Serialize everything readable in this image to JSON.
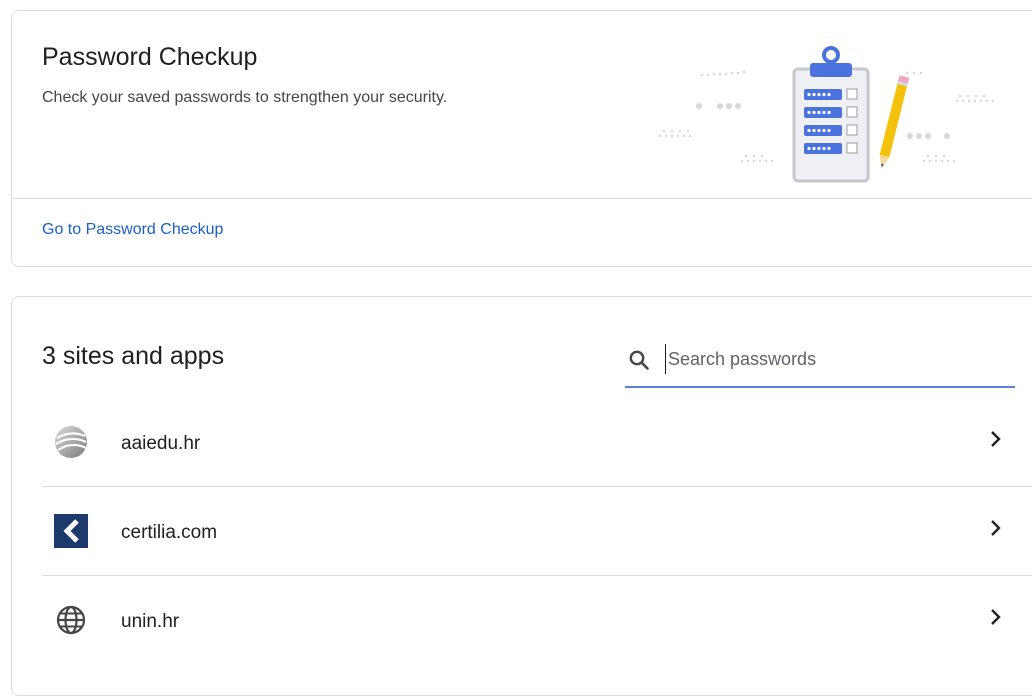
{
  "checkup": {
    "title": "Password Checkup",
    "description": "Check your saved passwords to strengthen your security.",
    "link_label": "Go to Password Checkup"
  },
  "sites": {
    "title": "3 sites and apps",
    "search_placeholder": "Search passwords",
    "items": [
      {
        "name": "aaiedu.hr",
        "icon": "aaiedu-favicon-icon"
      },
      {
        "name": "certilia.com",
        "icon": "certilia-favicon-icon"
      },
      {
        "name": "unin.hr",
        "icon": "globe-icon"
      }
    ]
  },
  "colors": {
    "link": "#1a5fc8",
    "search_underline": "#5c7fd6",
    "illustration_blue": "#4a73de",
    "pencil_yellow": "#f4c20d"
  }
}
